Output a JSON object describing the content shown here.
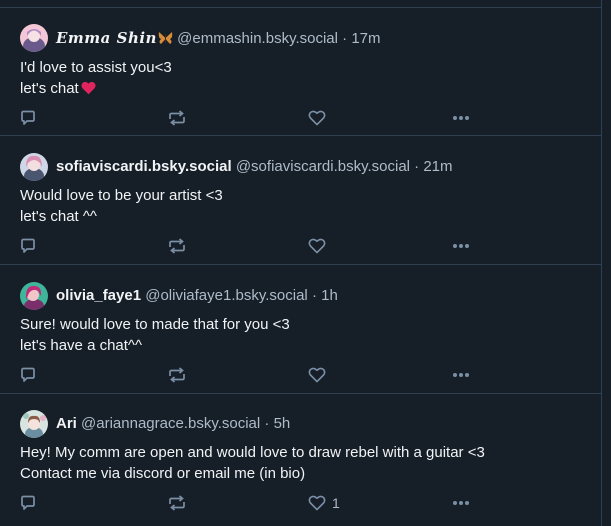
{
  "posts": [
    {
      "display_name": "𝑬𝒎𝒎𝒂 𝑺𝒉𝒊𝒏",
      "handle": "@emmashin.bsky.social",
      "separator": "·",
      "time": "17m",
      "lines": [
        "I'd love to assist you<3",
        "let's chat"
      ],
      "like_count": ""
    },
    {
      "display_name": "sofiaviscardi.bsky.social",
      "handle": "@sofiaviscardi.bsky.social",
      "separator": "·",
      "time": "21m",
      "lines": [
        "Would love to be your artist <3",
        "let's chat ^^"
      ],
      "like_count": ""
    },
    {
      "display_name": "olivia_faye1",
      "handle": "@oliviafaye1.bsky.social",
      "separator": "·",
      "time": "1h",
      "lines": [
        "Sure! would love to made that for you <3",
        "let's have a chat^^"
      ],
      "like_count": ""
    },
    {
      "display_name": "Ari",
      "handle": "@ariannagrace.bsky.social",
      "separator": "·",
      "time": "5h",
      "lines": [
        "Hey! My comm are open and would love to draw rebel with a guitar <3",
        "Contact me via discord or email me (in bio)"
      ],
      "like_count": "1"
    }
  ],
  "colors": {
    "background": "#161e27",
    "border": "#2e4052",
    "text": "#f1f3f5",
    "muted": "#aebbc9",
    "icon": "#7b8fa6",
    "heart_emoji": "#e0245e"
  },
  "icons": {
    "reply": "speech-bubble-icon",
    "repost": "repost-arrows-icon",
    "like": "heart-outline-icon",
    "more": "ellipsis-icon"
  }
}
